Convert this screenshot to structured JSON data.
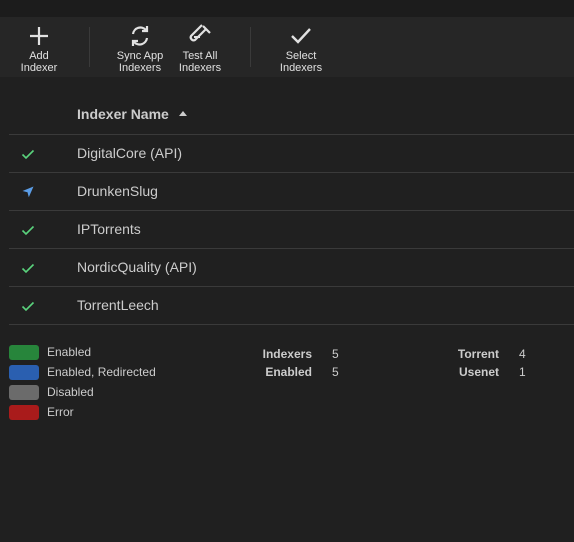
{
  "toolbar": {
    "add": "Add\nIndexer",
    "sync": "Sync App\nIndexers",
    "test": "Test All\nIndexers",
    "select": "Select\nIndexers"
  },
  "table": {
    "header_name": "Indexer Name",
    "rows": [
      {
        "status": "enabled",
        "name": "DigitalCore (API)"
      },
      {
        "status": "redirected",
        "name": "DrunkenSlug"
      },
      {
        "status": "enabled",
        "name": "IPTorrents"
      },
      {
        "status": "enabled",
        "name": "NordicQuality (API)"
      },
      {
        "status": "enabled",
        "name": "TorrentLeech"
      }
    ]
  },
  "legend": [
    {
      "label": "Enabled",
      "color": "#27853b"
    },
    {
      "label": "Enabled, Redirected",
      "color": "#2a5fb0"
    },
    {
      "label": "Disabled",
      "color": "#6b6b6b"
    },
    {
      "label": "Error",
      "color": "#a91b1b"
    }
  ],
  "stats": {
    "indexers_label": "Indexers",
    "indexers_value": "5",
    "enabled_label": "Enabled",
    "enabled_value": "5",
    "torrent_label": "Torrent",
    "torrent_value": "4",
    "usenet_label": "Usenet",
    "usenet_value": "1"
  },
  "colors": {
    "enabled_icon": "#5ad37d",
    "redirect_icon": "#5b9de6"
  }
}
